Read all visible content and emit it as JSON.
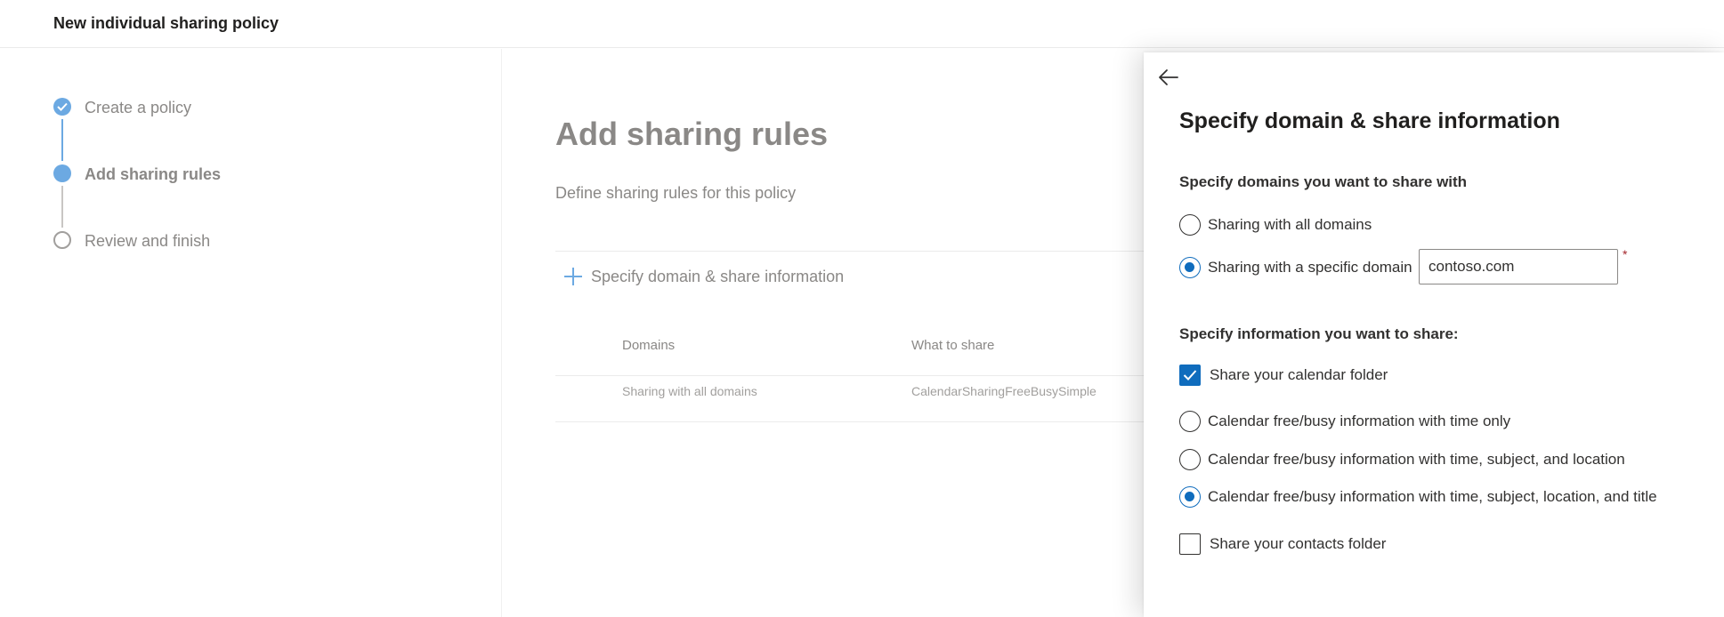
{
  "header": {
    "title": "New individual sharing policy"
  },
  "stepper": {
    "steps": [
      {
        "label": "Create a policy",
        "state": "completed"
      },
      {
        "label": "Add sharing rules",
        "state": "current"
      },
      {
        "label": "Review and finish",
        "state": "pending"
      }
    ]
  },
  "main": {
    "heading": "Add sharing rules",
    "subtitle": "Define sharing rules for this policy",
    "add_link": "Specify domain & share information",
    "table": {
      "columns": [
        "Domains",
        "What to share"
      ],
      "rows": [
        {
          "domain": "Sharing with all domains",
          "share": "CalendarSharingFreeBusySimple"
        }
      ]
    }
  },
  "panel": {
    "title": "Specify domain & share information",
    "domains_label": "Specify domains you want to share with",
    "domain_options": [
      {
        "label": "Sharing with all domains",
        "selected": false
      },
      {
        "label": "Sharing with a specific domain",
        "selected": true
      }
    ],
    "domain_input_value": "contoso.com",
    "required_marker": "*",
    "info_label": "Specify information you want to share:",
    "calendar_folder": {
      "label": "Share your calendar folder",
      "checked": true
    },
    "calendar_options": [
      {
        "label": "Calendar free/busy information with time only",
        "selected": false
      },
      {
        "label": "Calendar free/busy information with time, subject, and location",
        "selected": false
      },
      {
        "label": "Calendar free/busy information with time, subject, location, and title",
        "selected": true
      }
    ],
    "contacts_folder": {
      "label": "Share your contacts folder",
      "checked": false
    }
  },
  "colors": {
    "accent": "#0f6cbd",
    "step_accent": "#6ca9e2",
    "required": "#a4262c"
  },
  "icons": {
    "back": "arrow-left-icon",
    "step_done": "checkmark-icon",
    "add": "plus-icon",
    "checkbox_checked": "checkmark-icon"
  }
}
